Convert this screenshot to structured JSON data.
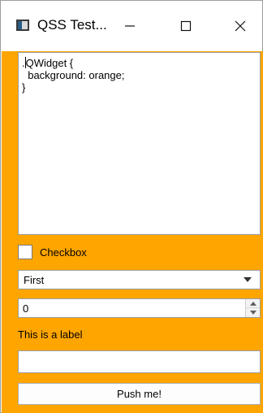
{
  "window": {
    "title": "QSS Test...",
    "background_color": "#ffa500"
  },
  "titlebar_buttons": {
    "minimize_icon": "minimize-icon",
    "maximize_icon": "maximize-icon",
    "close_icon": "close-icon"
  },
  "editor": {
    "lines": [
      ".QWidget {",
      "  background: orange;",
      "}"
    ]
  },
  "checkbox": {
    "label": "Checkbox",
    "checked": false
  },
  "combo": {
    "selected": "First"
  },
  "spinbox": {
    "value": "0"
  },
  "label": {
    "text": "This is a label"
  },
  "line_edit": {
    "value": ""
  },
  "button": {
    "label": "Push me!"
  }
}
